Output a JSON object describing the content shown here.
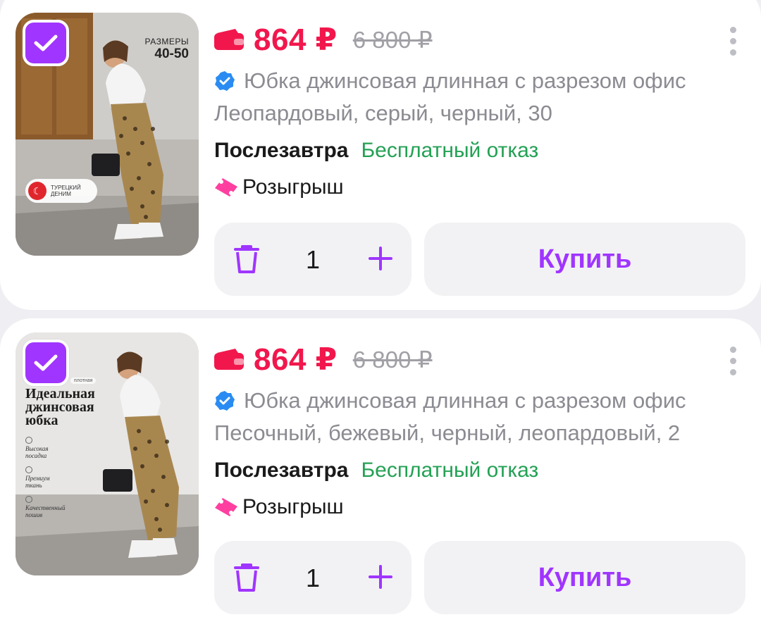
{
  "items": [
    {
      "selected": true,
      "price": "864 ₽",
      "old_price": "6 800 ₽",
      "title": "Юбка джинсовая длинная с разрезом офис",
      "variant": "Леопардовый, серый, черный, 30",
      "delivery": "Послезавтра",
      "refund": "Бесплатный отказ",
      "promo": "Розыгрыш",
      "quantity": "1",
      "buy_label": "Купить",
      "image_text": {
        "sizes_label": "РАЗМЕРЫ",
        "sizes_value": "40-50",
        "badge": "ТУРЕЦКИЙ ДЕНИМ"
      }
    },
    {
      "selected": true,
      "price": "864 ₽",
      "old_price": "6 800 ₽",
      "title": "Юбка джинсовая длинная с разрезом офис",
      "variant": "Песочный, бежевый, черный, леопардовый, 2",
      "delivery": "Послезавтра",
      "refund": "Бесплатный отказ",
      "promo": "Розыгрыш",
      "quantity": "1",
      "buy_label": "Купить",
      "image_text": {
        "tag": "плотная",
        "headline": "Идеальная джинсовая юбка",
        "feature_1": "Высокая посадка",
        "feature_2": "Премиум ткань",
        "feature_3": "Качественный пошив"
      }
    }
  ],
  "colors": {
    "accent": "#a035ff",
    "price": "#f1174c",
    "refund": "#24a155",
    "muted": "#8b8b92",
    "button_bg": "#f2f2f5"
  },
  "icons": [
    "check-icon",
    "wallet-icon",
    "more-icon",
    "verified-icon",
    "ticket-icon",
    "trash-icon",
    "plus-icon"
  ]
}
